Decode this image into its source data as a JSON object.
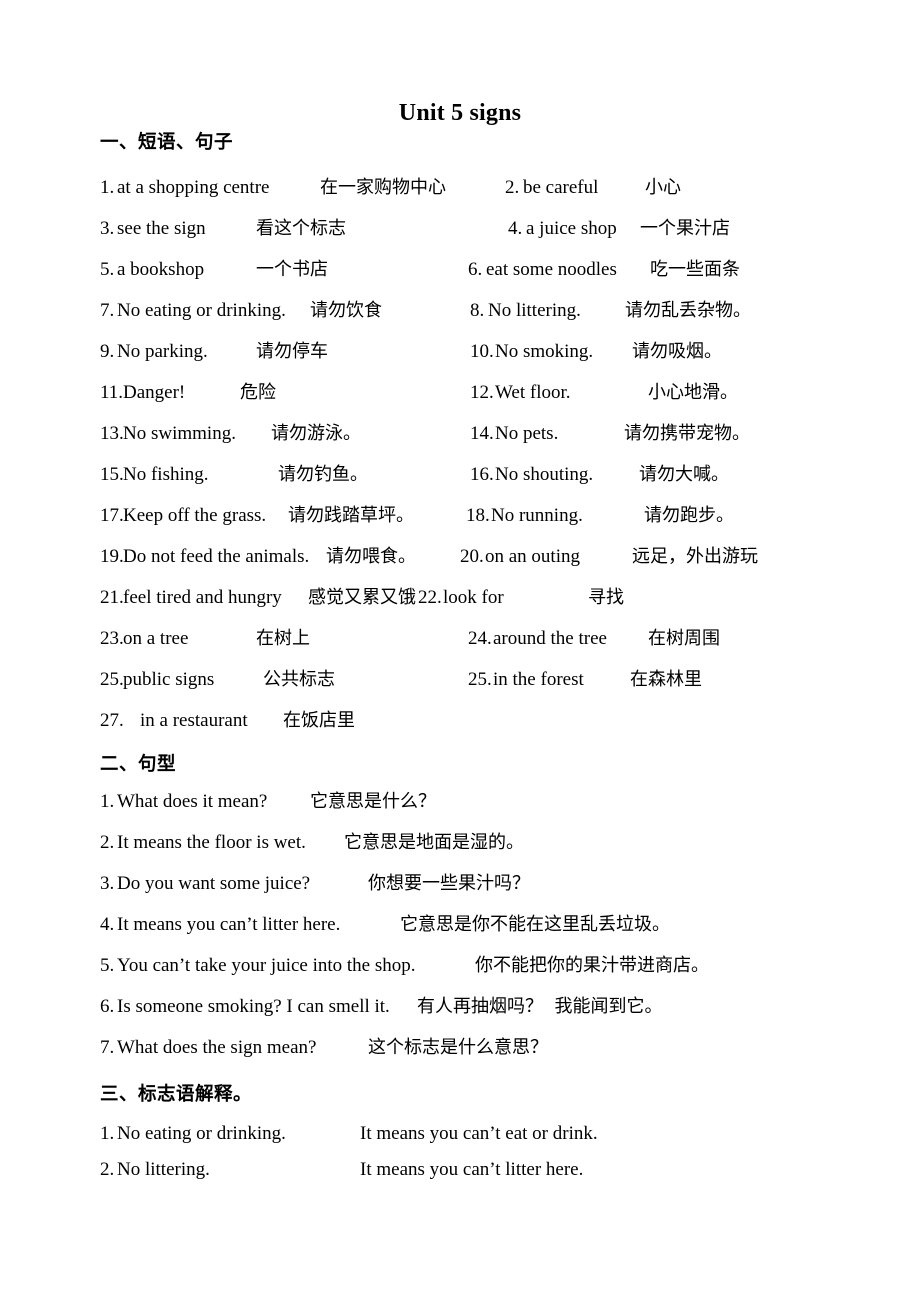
{
  "document": {
    "title": "Unit 5 signs",
    "page_bg": "#ffffff",
    "text_color": "#000000"
  },
  "sections": [
    {
      "heading": "一、短语、句子",
      "type": "two-column-phrases",
      "items": [
        {
          "num": "1.",
          "en": "at a shopping centre",
          "cn": "在一家购物中心"
        },
        {
          "num": "2.",
          "en": "be careful",
          "cn": "小心"
        },
        {
          "num": "3.",
          "en": "see the sign",
          "cn": "看这个标志"
        },
        {
          "num": "4.",
          "en": "a juice shop",
          "cn": "一个果汁店"
        },
        {
          "num": "5.",
          "en": "a bookshop",
          "cn": "一个书店"
        },
        {
          "num": "6.",
          "en": "eat some noodles",
          "cn": "吃一些面条"
        },
        {
          "num": "7.",
          "en": "No eating or drinking.",
          "cn": "请勿饮食"
        },
        {
          "num": "8.",
          "en": "No littering.",
          "cn": "请勿乱丢杂物。"
        },
        {
          "num": "9.",
          "en": "No parking.",
          "cn": "请勿停车"
        },
        {
          "num": "10.",
          "en": "No smoking.",
          "cn": "请勿吸烟。"
        },
        {
          "num": "11.",
          "en": "Danger!",
          "cn": "危险"
        },
        {
          "num": "12.",
          "en": "Wet floor.",
          "cn": "小心地滑。"
        },
        {
          "num": "13.",
          "en": "No swimming.",
          "cn": "请勿游泳。"
        },
        {
          "num": "14.",
          "en": "No pets.",
          "cn": "请勿携带宠物。"
        },
        {
          "num": "15.",
          "en": "No fishing.",
          "cn": "请勿钓鱼。"
        },
        {
          "num": "16.",
          "en": "No shouting.",
          "cn": "请勿大喊。"
        },
        {
          "num": "17.",
          "en": "Keep off the grass.",
          "cn": "请勿践踏草坪。"
        },
        {
          "num": "18.",
          "en": "No running.",
          "cn": "请勿跑步。"
        },
        {
          "num": "19.",
          "en": "Do not feed the animals.",
          "cn": "请勿喂食。"
        },
        {
          "num": "20.",
          "en": "on an outing",
          "cn": "远足，外出游玩"
        },
        {
          "num": "21.",
          "en": "feel tired and hungry",
          "cn": "感觉又累又饿"
        },
        {
          "num": "22.",
          "en": "look for",
          "cn": "寻找"
        },
        {
          "num": "23.",
          "en": "on a tree",
          "cn": "在树上"
        },
        {
          "num": "24.",
          "en": "around the tree",
          "cn": "在树周围"
        },
        {
          "num": "25.",
          "en": "public signs",
          "cn": "公共标志"
        },
        {
          "num": "25.",
          "en": "in the forest",
          "cn": "在森林里"
        },
        {
          "num": "27.",
          "en": "in a restaurant",
          "cn": "在饭店里"
        }
      ]
    },
    {
      "heading": "二、句型",
      "type": "sentence-patterns",
      "items": [
        {
          "num": "1.",
          "en": "What does it mean?",
          "cn": "它意思是什么？"
        },
        {
          "num": "2.",
          "en": "It means the floor is wet.",
          "cn": "它意思是地面是湿的。"
        },
        {
          "num": "3.",
          "en": "Do you want some juice?",
          "cn": "你想要一些果汁吗？"
        },
        {
          "num": "4.",
          "en": "It means you can’t litter here.",
          "cn": "它意思是你不能在这里乱丢垃圾。"
        },
        {
          "num": "5.",
          "en": "You can’t take your juice into the shop.",
          "cn": "你不能把你的果汁带进商店。"
        },
        {
          "num": "6.",
          "en": "Is someone smoking? I can smell it.",
          "cn": "有人再抽烟吗？  我能闻到它。"
        },
        {
          "num": "7.",
          "en": "What does the sign mean?",
          "cn": "这个标志是什么意思？"
        }
      ]
    },
    {
      "heading": "三、标志语解释。",
      "type": "sign-explanations",
      "items": [
        {
          "num": "1.",
          "sign": "No eating or drinking.",
          "meaning": "It means you can’t eat or drink."
        },
        {
          "num": "2.",
          "sign": "No littering.",
          "meaning": "It means you can’t litter here."
        }
      ]
    }
  ]
}
